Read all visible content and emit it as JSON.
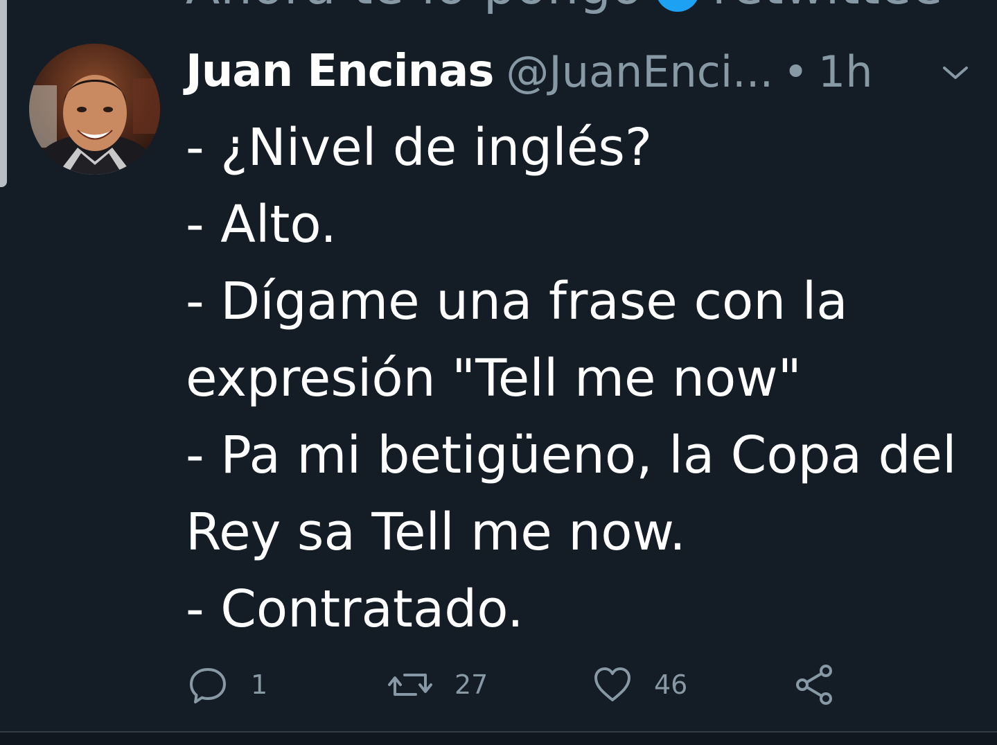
{
  "colors": {
    "background": "#141d26",
    "primary_text": "#ffffff",
    "secondary_text": "#8899a6",
    "divider": "#2f3b47"
  },
  "tweet": {
    "author_name": "Juan Encinas",
    "handle": "@JuanEnci...",
    "separator": "•",
    "time": "1h",
    "lines": [
      "- ¿Nivel de inglés?",
      "- Alto.",
      "- Dígame una frase con la",
      "expresión \"Tell me now\"",
      "- Pa mi betigüeno, la Copa del",
      "Rey sa Tell me now.",
      "- Contratado."
    ]
  },
  "actions": {
    "reply": {
      "icon": "reply-icon",
      "count": "1"
    },
    "retweet": {
      "icon": "retweet-icon",
      "count": "27"
    },
    "like": {
      "icon": "heart-icon",
      "count": "46"
    },
    "share": {
      "icon": "share-icon"
    }
  }
}
